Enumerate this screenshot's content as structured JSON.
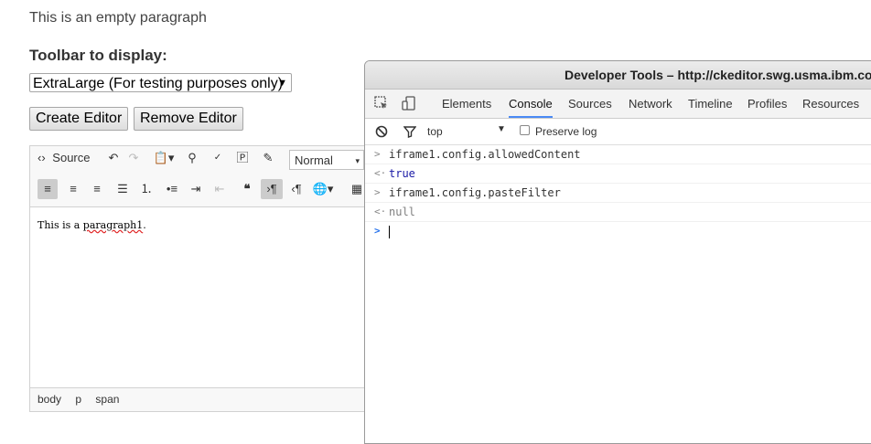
{
  "page": {
    "intro_text": "This is an empty paragraph",
    "toolbar_label": "Toolbar to display:",
    "toolbar_select_value": "ExtraLarge (For testing purposes only)",
    "create_button": "Create Editor",
    "remove_button": "Remove Editor"
  },
  "editor": {
    "source_label": "Source",
    "format_value": "Normal",
    "content_prefix": "This is a ",
    "content_misspelled": "paragraph1",
    "content_suffix": ".",
    "elements_path": [
      "body",
      "p",
      "span"
    ]
  },
  "devtools": {
    "title": "Developer Tools – http://ckeditor.swg.usma.ibm.com",
    "tabs": [
      "Elements",
      "Console",
      "Sources",
      "Network",
      "Timeline",
      "Profiles",
      "Resources"
    ],
    "active_tab": "Console",
    "context_value": "top",
    "preserve_log_label": "Preserve log",
    "console_lines": [
      {
        "type": "input",
        "text": "iframe1.config.allowedContent"
      },
      {
        "type": "output",
        "text": "true"
      },
      {
        "type": "input",
        "text": "iframe1.config.pasteFilter"
      },
      {
        "type": "output",
        "text": "null"
      }
    ]
  }
}
